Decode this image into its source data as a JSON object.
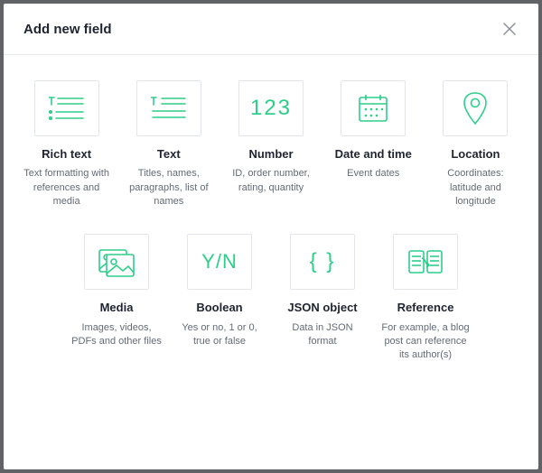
{
  "header": {
    "title": "Add new field"
  },
  "fields": {
    "rich_text": {
      "title": "Rich text",
      "desc": "Text formatting with references and media"
    },
    "text": {
      "title": "Text",
      "desc": "Titles, names, paragraphs, list of names"
    },
    "number": {
      "title": "Number",
      "desc": "ID, order number, rating, quantity",
      "glyph": "123"
    },
    "date_time": {
      "title": "Date and time",
      "desc": "Event dates"
    },
    "location": {
      "title": "Location",
      "desc": "Coordinates: latitude and longitude"
    },
    "media": {
      "title": "Media",
      "desc": "Images, videos, PDFs and other files"
    },
    "boolean": {
      "title": "Boolean",
      "desc": "Yes or no, 1 or 0, true or false",
      "glyph": "Y/N"
    },
    "json_object": {
      "title": "JSON object",
      "desc": "Data in JSON format",
      "glyph": "{ }"
    },
    "reference": {
      "title": "Reference",
      "desc": "For example, a blog post can reference its author(s)"
    }
  }
}
